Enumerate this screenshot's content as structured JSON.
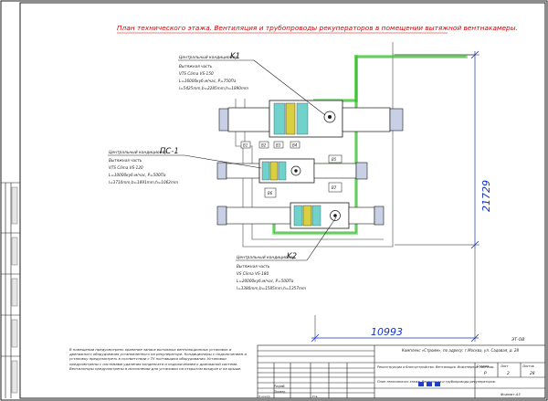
{
  "drawing": {
    "title": "План технического этажа. Вентиляция и трубопроводы рекуператоров в помещении вытяжной вентнакамеры.",
    "dim_horizontal": "10993",
    "dim_vertical": "21729"
  },
  "units": [
    {
      "tag": "K1",
      "name": "Центральный кондиционер",
      "part": "Вытяжная часть",
      "model": "VTS Clima VS-150",
      "flow": "L=16000куб.м/час, P=750Па",
      "size": "l=5425mm,b=2285mm,h=1890mm"
    },
    {
      "tag": "ПС-1",
      "name": "Центральный кондиционер",
      "part": "Вытяжная часть",
      "model": "VTS Clima VS-120",
      "flow": "L=10000куб.м/час, P=500Па",
      "size": "l=3710mm,b=1891mm,h=1062mm"
    },
    {
      "tag": "K2",
      "name": "Центральный кондиционер",
      "part": "Вытяжная часть",
      "model": "VS Clima VS-180",
      "flow": "L=20000куб.м/час, P=500Па",
      "size": "l=3380mm,b=1585mm,h=1357mm"
    }
  ],
  "equipment_labels": {
    "v1": "В1",
    "v2": "В2",
    "v3": "В3",
    "v4": "В4",
    "v5": "В5",
    "v6": "В6",
    "v7": "В7"
  },
  "notes": "В помещении предусмотрено хранение запаса вытяжных вентиляционных установок и дренажного оборудования установленного на рекуператоре. Кондиционеры с подключением и установку предусмотреть в соответствии с ТУ поставщика оборудования. Установки предусмотрены с системами удаления конденсата и подключением к дренажной системе. Вентиляторы предусмотрены в исполнении для установки на открытом воздухе и на крыше.",
  "title_block": {
    "sheet_code": "ЭТ-ОВ",
    "customer": "Комплекс «Строим», по адресу: г.Москва, ул. Садовая, д. 28",
    "project": "Реконструкция и благоустройство. Вентиляция. Инженерные системы.",
    "sheet_title": "План технического этажа. Вентиляция и трубопроводы рекуператоров.",
    "stage": "Р",
    "sheet": "2",
    "sheets": "28",
    "col_stage": "Стадия",
    "col_sheet": "Лист",
    "col_sheets": "Листов",
    "format": "Формат А3",
    "rows": [
      "Разраб.",
      "Провер.",
      "Н.контр.",
      "Утв."
    ]
  },
  "colors": {
    "duct_green": "#4fd43f",
    "line": "#1a1a1a",
    "coil_yellow": "#d8d040",
    "section_cyan": "#4ec8c0",
    "dim_blue": "#1030d0",
    "title_red": "#d40000"
  }
}
